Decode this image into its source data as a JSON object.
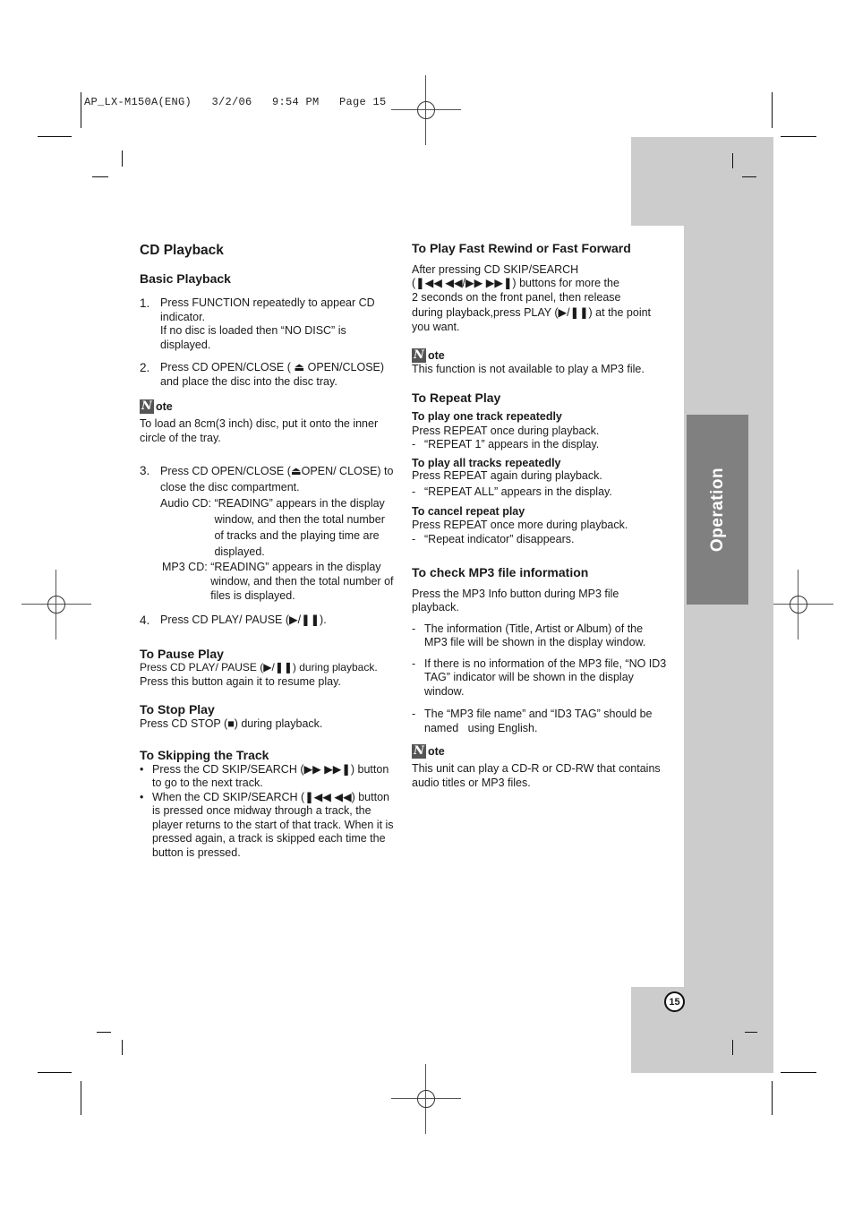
{
  "print_header": "AP_LX-M150A(ENG)   3/2/06   9:54 PM   Page 15",
  "side_tab": {
    "label": "Operation",
    "tab_color": "#808080",
    "band_color": "#cccccc"
  },
  "page_number": "15",
  "left": {
    "title": "CD Playback",
    "basic": {
      "heading": "Basic Playback",
      "steps": [
        {
          "num": "1.",
          "lines": [
            "Press FUNCTION repeatedly to appear CD indicator.",
            "If no disc is loaded then “NO DISC” is displayed."
          ]
        },
        {
          "num": "2.",
          "text": "Press CD OPEN/CLOSE ( ⏏ OPEN/CLOSE) and place the disc into the disc tray."
        }
      ],
      "note": {
        "label": "ote",
        "icon": "N",
        "text": "To load an 8cm(3 inch) disc, put it onto the inner circle of the tray."
      },
      "step3": {
        "num": "3.",
        "text": "Press CD OPEN/CLOSE (⏏OPEN/ CLOSE) to close the disc compartment.",
        "audio_label": "Audio CD: ",
        "audio_text": "“READING” appears in the display window, and then the total number of tracks and the playing time are displayed.",
        "mp3_label": "MP3 CD: ",
        "mp3_text": "“READING” appears in the display window, and then the total number of files is displayed."
      },
      "step4": {
        "num": "4.",
        "text": "Press CD PLAY/ PAUSE (▶/❚❚)."
      }
    },
    "pause": {
      "heading": "To Pause Play",
      "lines": [
        "Press CD PLAY/ PAUSE (▶/❚❚) during playback.",
        "Press this button again it to resume play."
      ]
    },
    "stop": {
      "heading": "To Stop Play",
      "text": "Press CD STOP (■) during playback."
    },
    "skip": {
      "heading": "To Skipping the Track",
      "bullets": [
        "Press the CD SKIP/SEARCH (▶▶ ▶▶❚) button to go to the next track.",
        "When the CD SKIP/SEARCH (❚◀◀ ◀◀) button is pressed once midway through a track, the player returns to the start of that track. When it is pressed again, a track is skipped each time the button is pressed."
      ]
    }
  },
  "right": {
    "fast": {
      "heading": "To Play Fast Rewind or Fast Forward",
      "lines": [
        "After pressing CD SKIP/SEARCH",
        "(❚◀◀ ◀◀/▶▶ ▶▶❚) buttons for more the",
        "2 seconds on the front panel, then release",
        "during playback,press PLAY (▶/❚❚) at the point you want."
      ],
      "note": {
        "label": "ote",
        "icon": "N",
        "text": "This function is not available to play a MP3 file."
      }
    },
    "repeat": {
      "heading": "To Repeat Play",
      "groups": [
        {
          "title": "To play one track repeatedly",
          "text": "Press REPEAT once during playback.",
          "result": "“REPEAT 1” appears in the display."
        },
        {
          "title": "To play all tracks repeatedly",
          "text": "Press REPEAT again during playback.",
          "result": "“REPEAT ALL” appears in the display."
        },
        {
          "title": "To cancel repeat play",
          "text": "Press REPEAT once more during playback.",
          "result": "“Repeat  indicator” disappears."
        }
      ]
    },
    "mp3": {
      "heading": "To check MP3 file information",
      "intro": "Press the MP3 Info button during MP3 file playback.",
      "items": [
        "The information (Title, Artist or Album) of the MP3 file will be shown in the display window.",
        "If there is no information of the MP3 file, “NO ID3 TAG” indicator will be shown in the display window.",
        "The “MP3 file name” and “ID3 TAG” should be named   using English."
      ],
      "note": {
        "label": "ote",
        "icon": "N",
        "text": "This unit can play a CD-R or CD-RW that contains audio titles or MP3 files."
      }
    }
  },
  "dash": "-",
  "bullet": "•"
}
